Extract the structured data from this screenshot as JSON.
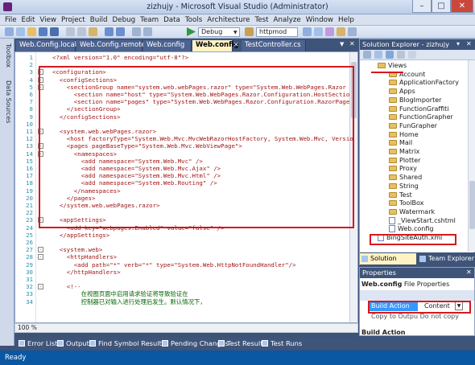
{
  "window": {
    "title": "zizhujy - Microsoft Visual Studio (Administrator)",
    "controls": [
      "–",
      "□",
      "✕"
    ]
  },
  "menu": [
    "File",
    "Edit",
    "View",
    "Project",
    "Build",
    "Debug",
    "Team",
    "Data",
    "Tools",
    "Architecture",
    "Test",
    "Analyze",
    "Window",
    "Help"
  ],
  "toolbar": {
    "config": "Debug",
    "find": "httpmod"
  },
  "side_tabs": [
    "Toolbox",
    "Data Sources"
  ],
  "doc_tabs": [
    "Web.Config.local",
    "Web.Config.remote",
    "Web.config",
    "Web.config",
    "TestController.cs"
  ],
  "active_doc_tab": 3,
  "code_lines": [
    {
      "n": "1",
      "t": "<?xml version=\"1.0\" encoding=\"utf-8\"?>",
      "m": ""
    },
    {
      "n": "2",
      "t": "",
      "m": ""
    },
    {
      "n": "3",
      "t": "<configuration>",
      "m": "-"
    },
    {
      "n": "4",
      "t": "  <configSections>",
      "m": "-"
    },
    {
      "n": "5",
      "t": "    <sectionGroup name=\"system.web.webPages.razor\" type=\"System.Web.WebPages.Razor",
      "m": "-"
    },
    {
      "n": "6",
      "t": "      <section name=\"host\" type=\"System.Web.WebPages.Razor.Configuration.HostSectio",
      "m": ""
    },
    {
      "n": "7",
      "t": "      <section name=\"pages\" type=\"System.Web.WebPages.Razor.Configuration.RazorPage",
      "m": ""
    },
    {
      "n": "8",
      "t": "    </sectionGroup>",
      "m": ""
    },
    {
      "n": "9",
      "t": "  </configSections>",
      "m": ""
    },
    {
      "n": "10",
      "t": "",
      "m": ""
    },
    {
      "n": "11",
      "t": "  <system.web.webPages.razor>",
      "m": "-"
    },
    {
      "n": "12",
      "t": "    <host factoryType=\"System.Web.Mvc.MvcWebRazorHostFactory, System.Web.Mvc, Versio",
      "m": ""
    },
    {
      "n": "13",
      "t": "    <pages pageBaseType=\"System.Web.Mvc.WebViewPage\">",
      "m": "-"
    },
    {
      "n": "14",
      "t": "      <namespaces>",
      "m": "-"
    },
    {
      "n": "15",
      "t": "        <add namespace=\"System.Web.Mvc\" />",
      "m": ""
    },
    {
      "n": "16",
      "t": "        <add namespace=\"System.Web.Mvc.Ajax\" />",
      "m": ""
    },
    {
      "n": "17",
      "t": "        <add namespace=\"System.Web.Mvc.Html\" />",
      "m": ""
    },
    {
      "n": "18",
      "t": "        <add namespace=\"System.Web.Routing\" />",
      "m": ""
    },
    {
      "n": "19",
      "t": "      </namespaces>",
      "m": ""
    },
    {
      "n": "20",
      "t": "    </pages>",
      "m": ""
    },
    {
      "n": "21",
      "t": "  </system.web.webPages.razor>",
      "m": ""
    },
    {
      "n": "22",
      "t": "",
      "m": ""
    },
    {
      "n": "23",
      "t": "  <appSettings>",
      "m": "-"
    },
    {
      "n": "24",
      "t": "    <add key=\"webpages:Enabled\" value=\"false\" />",
      "m": ""
    },
    {
      "n": "25",
      "t": "  </appSettings>",
      "m": ""
    },
    {
      "n": "26",
      "t": "",
      "m": ""
    },
    {
      "n": "27",
      "t": "  <system.web>",
      "m": "-"
    },
    {
      "n": "28",
      "t": "    <httpHandlers>",
      "m": "-"
    },
    {
      "n": "29",
      "t": "      <add path=\"*\" verb=\"*\" type=\"System.Web.HttpNotFoundHandler\"/>",
      "m": ""
    },
    {
      "n": "30",
      "t": "    </httpHandlers>",
      "m": ""
    },
    {
      "n": "31",
      "t": "",
      "m": ""
    },
    {
      "n": "32",
      "t": "    <!--",
      "m": "-"
    },
    {
      "n": "33",
      "t": "        在视图页面中启用请求验证将导致验证在",
      "m": ""
    },
    {
      "n": "34",
      "t": "        控制器已对输入进行处理后发生。默认情况下，",
      "m": ""
    }
  ],
  "zoom": "100 %",
  "solution_explorer": {
    "title": "Solution Explorer - zizhujy",
    "items": [
      {
        "label": "Views",
        "kind": "folder",
        "indent": 1
      },
      {
        "label": "Account",
        "kind": "folder",
        "indent": 2
      },
      {
        "label": "ApplicationFactory",
        "kind": "folder",
        "indent": 2
      },
      {
        "label": "Apps",
        "kind": "folder",
        "indent": 2
      },
      {
        "label": "BlogImporter",
        "kind": "folder",
        "indent": 2
      },
      {
        "label": "FunctionGraffiti",
        "kind": "folder",
        "indent": 2
      },
      {
        "label": "FunctionGrapher",
        "kind": "folder",
        "indent": 2
      },
      {
        "label": "FunGrapher",
        "kind": "folder",
        "indent": 2
      },
      {
        "label": "Home",
        "kind": "folder",
        "indent": 2
      },
      {
        "label": "Mail",
        "kind": "folder",
        "indent": 2
      },
      {
        "label": "Matrix",
        "kind": "folder",
        "indent": 2
      },
      {
        "label": "Plotter",
        "kind": "folder",
        "indent": 2
      },
      {
        "label": "Proxy",
        "kind": "folder",
        "indent": 2
      },
      {
        "label": "Shared",
        "kind": "folder",
        "indent": 2
      },
      {
        "label": "String",
        "kind": "folder",
        "indent": 2
      },
      {
        "label": "Test",
        "kind": "folder",
        "indent": 2
      },
      {
        "label": "ToolBox",
        "kind": "folder",
        "indent": 2
      },
      {
        "label": "Watermark",
        "kind": "folder",
        "indent": 2
      },
      {
        "label": "_ViewStart.cshtml",
        "kind": "file",
        "indent": 2
      },
      {
        "label": "Web.config",
        "kind": "file",
        "indent": 2
      },
      {
        "label": "BingSiteAuth.xml",
        "kind": "file",
        "indent": 1
      }
    ],
    "tabs": [
      "Solution Expl...",
      "Team Explorer"
    ]
  },
  "properties": {
    "title": "Properties",
    "subject": "Web.config",
    "subject_type": "File Properties",
    "rows": [
      {
        "name": "Build Action",
        "value": "Content"
      },
      {
        "name": "",
        "value": "Copy to Outpu Do not copy"
      }
    ],
    "desc_title": "Build Action"
  },
  "bottom_tabs": [
    "Error List",
    "Output",
    "Find Symbol Results",
    "Pending Changes",
    "Test Results",
    "Test Runs"
  ],
  "status": "Ready",
  "colors": {
    "highlight": "#d6181f",
    "statusbar": "#0a57a3",
    "tab_active": "#fff3c4"
  }
}
